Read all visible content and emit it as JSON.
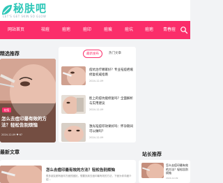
{
  "header": {
    "logo_text": "秘肤吧",
    "logo_sub": "LET'S GET SKIN SO GLOW"
  },
  "nav": {
    "items": [
      "网站首页",
      "祛痘",
      "痘疤",
      "痘印",
      "痘痕",
      "痘坑",
      "痘疤",
      "青春痘"
    ],
    "search_icon": "search-icon"
  },
  "featured": {
    "section_title": "精选推荐",
    "badge": "祛痘",
    "title": "怎么去痘印最有效的方法？轻松告别烦恼",
    "meta": "2024-12-09   ♥ 67"
  },
  "tabs": [
    {
      "label": "最新发布",
      "active": true
    },
    {
      "label": "热门文章",
      "active": false
    }
  ],
  "list_items": [
    {
      "title": "痘坑治疗哪家好？专业祛痘疤痕修复权威指南",
      "date": "2024-12-09"
    },
    {
      "title": "脸上的痘坑能修复吗？全面解析与实用建议",
      "date": "2024-12-09"
    },
    {
      "title": "激光祛痘印效果好吗：怀孕期间可以做吗？",
      "date": "2024-12-09"
    }
  ],
  "latest": {
    "section_title": "最新文章",
    "title": "怎么去痘印最有效的方法？轻松告别烦恼",
    "desc": "很多朋友都有痘印方面的困扰，想要找到去痘印最有效的方法，下面为你详细介绍…"
  },
  "sidebar": {
    "section_title": "站长推荐",
    "title": "怎么去痘印最有效的方法？轻松告别烦恼",
    "date": "2024-12-09"
  },
  "colors": {
    "accent": "#fb2d6a",
    "brand": "#2ec7b8",
    "background": "#f2f3f5"
  }
}
